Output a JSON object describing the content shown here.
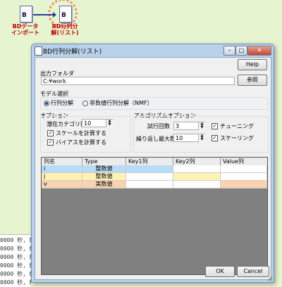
{
  "canvas": {
    "node1": {
      "label": "BDデータ\nインポート",
      "icon": "doc-import-icon"
    },
    "node2": {
      "label": "BD行列分\n解(リスト)",
      "icon": "doc-factorize-icon"
    }
  },
  "log": {
    "lines": [
      "0000 秒, 経",
      "0000 秒, 経",
      "0000 秒, 経",
      "0000 秒, 経",
      "0000 秒, 経",
      "0000 秒, 経"
    ]
  },
  "dialog": {
    "title": "BD行列分解(リスト)",
    "help_label": "Help",
    "output_folder": {
      "group_label": "出力フォルダ",
      "value": "C:¥work",
      "browse_label": "参照"
    },
    "model": {
      "group_label": "モデル選択",
      "options": [
        {
          "label": "行列分解",
          "selected": true
        },
        {
          "label": "非負値行列分解（NMF）",
          "selected": false
        }
      ]
    },
    "options": {
      "group_label": "オプション",
      "latent_label": "潜在カテゴリ数",
      "latent_value": "10",
      "checks": [
        {
          "label": "スケールを計算する",
          "checked": true
        },
        {
          "label": "バイアスを計算する",
          "checked": true
        }
      ]
    },
    "algo": {
      "group_label": "アルゴリズムオプション",
      "trials_label": "試行回数",
      "trials_value": "3",
      "maxiter_label": "繰り返し最大数",
      "maxiter_value": "10",
      "checks": [
        {
          "label": "チューニング",
          "checked": true
        },
        {
          "label": "スケーリング",
          "checked": true
        }
      ]
    },
    "table": {
      "headers": [
        "列名",
        "Type",
        "Key1列",
        "Key2列",
        "Value列"
      ],
      "rows": [
        {
          "name": "i",
          "type": "整数値",
          "color": "#b8dcf5",
          "highlight": 2
        },
        {
          "name": "j",
          "type": "整数値",
          "color": "#fff2b3",
          "highlight": 3
        },
        {
          "name": "v",
          "type": "実数値",
          "color": "#f9d2b0",
          "highlight": 4
        }
      ]
    },
    "ok_label": "OK",
    "cancel_label": "Cancel"
  }
}
